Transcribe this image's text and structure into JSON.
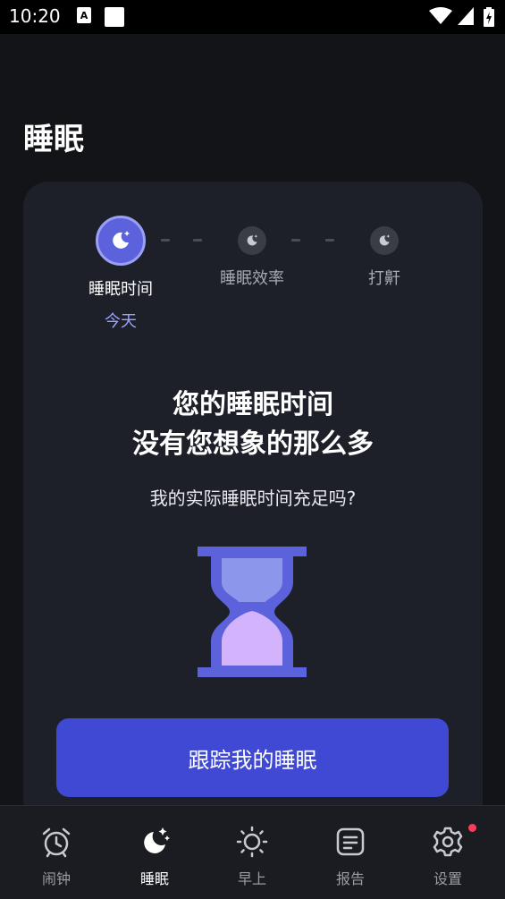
{
  "status_bar": {
    "time": "10:20"
  },
  "page": {
    "title": "睡眠"
  },
  "steps": [
    {
      "label": "睡眠时间",
      "sub": "今天",
      "active": true
    },
    {
      "label": "睡眠效率",
      "active": false
    },
    {
      "label": "打鼾",
      "active": false
    }
  ],
  "main": {
    "headline_line1": "您的睡眠时间",
    "headline_line2": "没有您想象的那么多",
    "subline": "我的实际睡眠时间充足吗?",
    "cta_label": "跟踪我的睡眠"
  },
  "bottom_nav": [
    {
      "label": "闹钟",
      "icon": "alarm-clock-icon",
      "active": false
    },
    {
      "label": "睡眠",
      "icon": "moon-stars-icon",
      "active": true
    },
    {
      "label": "早上",
      "icon": "sun-icon",
      "active": false
    },
    {
      "label": "报告",
      "icon": "report-icon",
      "active": false
    },
    {
      "label": "设置",
      "icon": "gear-icon",
      "active": false,
      "badge": true
    }
  ],
  "colors": {
    "background": "#131418",
    "card": "#1e2029",
    "accent": "#4049d4",
    "active_step": "#5b62dc",
    "step_sub": "#9ba2ff",
    "hourglass_frame": "#5b62dc",
    "hourglass_top_sand": "#8c97ec",
    "hourglass_bottom_sand": "#d3b3fb",
    "badge": "#ff3b5c"
  }
}
